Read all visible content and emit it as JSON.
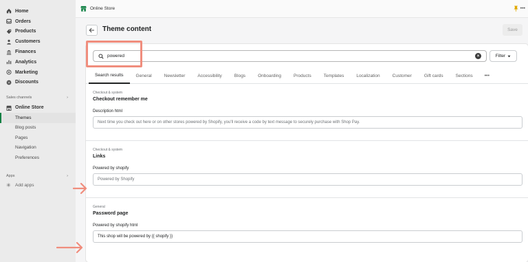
{
  "sidebar": {
    "nav": [
      {
        "label": "Home",
        "icon": "home-icon"
      },
      {
        "label": "Orders",
        "icon": "orders-icon"
      },
      {
        "label": "Products",
        "icon": "tag-icon"
      },
      {
        "label": "Customers",
        "icon": "person-icon"
      },
      {
        "label": "Finances",
        "icon": "bank-icon"
      },
      {
        "label": "Analytics",
        "icon": "bar-chart-icon"
      },
      {
        "label": "Marketing",
        "icon": "target-icon"
      },
      {
        "label": "Discounts",
        "icon": "discount-icon"
      }
    ],
    "sales_channels_label": "Sales channels",
    "online_store_label": "Online Store",
    "online_store_items": [
      "Themes",
      "Blog posts",
      "Pages",
      "Navigation",
      "Preferences"
    ],
    "apps_label": "Apps",
    "add_apps_label": "Add apps"
  },
  "topbar": {
    "title": "Online Store",
    "more": "•••"
  },
  "page": {
    "title": "Theme content",
    "save_label": "Save"
  },
  "search": {
    "value": "powered",
    "filter_label": "Filter",
    "clear": "×"
  },
  "tabs": [
    "Search results",
    "General",
    "Newsletter",
    "Accessibility",
    "Blogs",
    "Onboarding",
    "Products",
    "Templates",
    "Localization",
    "Customer",
    "Gift cards",
    "Sections"
  ],
  "tabs_more": "•••",
  "results": [
    {
      "category": "Checkout & system",
      "title": "Checkout remember me",
      "field_label": "Description html",
      "field_value": "Next time you check out here or on other stores powered by Shopify, you'll receive a code by text message to securely purchase with Shop Pay."
    },
    {
      "category": "Checkout & system",
      "title": "Links",
      "field_label": "Powered by shopify",
      "field_value": "Powered by Shopify"
    },
    {
      "category": "General",
      "title": "Password page",
      "field_label": "Powered by shopify html",
      "field_value": "This shop will be powered by {{ shopify }}"
    }
  ],
  "colors": {
    "annotation": "#f08d7d",
    "active_channel": "#108043"
  }
}
